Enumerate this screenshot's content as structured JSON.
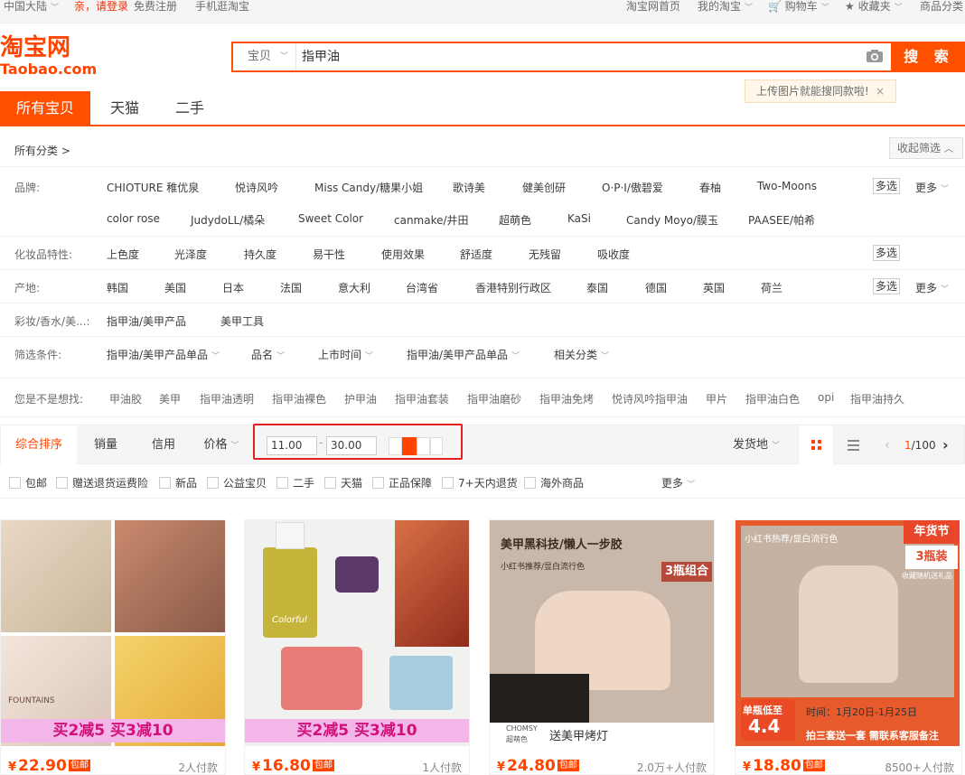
{
  "topbar": {
    "region": "中国大陆",
    "login": "亲，请登录",
    "register": "免费注册",
    "mobile": "手机逛淘宝",
    "home": "淘宝网首页",
    "my_taobao": "我的淘宝",
    "cart": "购物车",
    "favorites": "收藏夹",
    "categories": "商品分类"
  },
  "logo": {
    "cn": "淘宝网",
    "en": "Taobao.com"
  },
  "search": {
    "scope": "宝贝",
    "query": "指甲油",
    "button": "搜 索",
    "tip": "上传图片就能搜同款啦!",
    "tip_close": "×"
  },
  "tabs": [
    "所有宝贝",
    "天猫",
    "二手"
  ],
  "filters": {
    "all_categories": "所有分类 >",
    "collapse": "收起筛选",
    "multi_select": "多选",
    "more": "更多",
    "rows": [
      {
        "label": "品牌:",
        "values": [
          "CHIOTURE 稚优泉",
          "悦诗风吟",
          "Miss Candy/糖果小姐",
          "歌诗美",
          "健美创研",
          "O·P·I/傲碧爱",
          "春柚",
          "Two-Moons"
        ],
        "values2": [
          "color rose",
          "JudydoLL/橘朵",
          "Sweet Color",
          "canmake/井田",
          "超萌色",
          "KaSi",
          "Candy Moyo/膜玉",
          "PAASEE/帕希"
        ]
      },
      {
        "label": "化妆品特性:",
        "values": [
          "上色度",
          "光泽度",
          "持久度",
          "易干性",
          "使用效果",
          "舒适度",
          "无残留",
          "吸收度"
        ]
      },
      {
        "label": "产地:",
        "values": [
          "韩国",
          "美国",
          "日本",
          "法国",
          "意大利",
          "台湾省",
          "香港特别行政区",
          "泰国",
          "德国",
          "英国",
          "荷兰"
        ]
      },
      {
        "label": "彩妆/香水/美...:",
        "values": [
          "指甲油/美甲产品",
          "美甲工具"
        ]
      },
      {
        "label": "筛选条件:",
        "values": [
          "指甲油/美甲产品单品",
          "品名",
          "上市时间",
          "指甲油/美甲产品单品",
          "相关分类"
        ]
      }
    ]
  },
  "suggestions": {
    "label": "您是不是想找:",
    "items": [
      "甲油胶",
      "美甲",
      "指甲油透明",
      "指甲油裸色",
      "护甲油",
      "指甲油套装",
      "指甲油磨砂",
      "指甲油免烤",
      "悦诗风吟指甲油",
      "甲片",
      "指甲油白色",
      "opi",
      "指甲油持久"
    ]
  },
  "sort": {
    "items": [
      "综合排序",
      "销量",
      "信用",
      "价格"
    ],
    "price_min": "11.00",
    "price_sep": "-",
    "price_max": "30.00",
    "ship_from": "发货地",
    "page": "1/100",
    "page_current": "1",
    "page_total": "/100"
  },
  "options": [
    "包邮",
    "赠送退货运费险",
    "新品",
    "公益宝贝",
    "二手",
    "天猫",
    "正品保障",
    "7+天内退货",
    "海外商品"
  ],
  "options_more": "更多",
  "products": [
    {
      "price": "22.90",
      "badge": "包邮",
      "sold": "2人付款",
      "banner": "买2减5 买3减10",
      "img_text": "FOUNTAINS"
    },
    {
      "price": "16.80",
      "badge": "包邮",
      "sold": "1人付款",
      "banner": "买2减5 买3减10",
      "img_text": "Colorful"
    },
    {
      "price": "24.80",
      "badge": "包邮",
      "sold": "2.0万+人付款",
      "title": "美甲黑科技/懒人一步胶",
      "subtitle": "小红书推荐/显白流行色",
      "tag": "3瓶组合",
      "bottom_brand": "CHOMSY",
      "bottom_brand_cn": "超萌色",
      "bottom": "送美甲烤灯"
    },
    {
      "price": "18.80",
      "badge": "包邮",
      "sold": "8500+人付款",
      "corner": "年货节",
      "corner2": "3瓶装",
      "corner3": "收藏随机送礼品",
      "title": "小红书热荐/显白流行色",
      "lead1": "单瓶低至",
      "lead_price": "4.4",
      "time": "时间：1月20日-1月25日",
      "bottom": "拍三套送一套 需联系客服备注"
    }
  ],
  "colors": {
    "accent": "#ff5000",
    "price": "#ff4400",
    "highlight": "#e31e1e"
  }
}
